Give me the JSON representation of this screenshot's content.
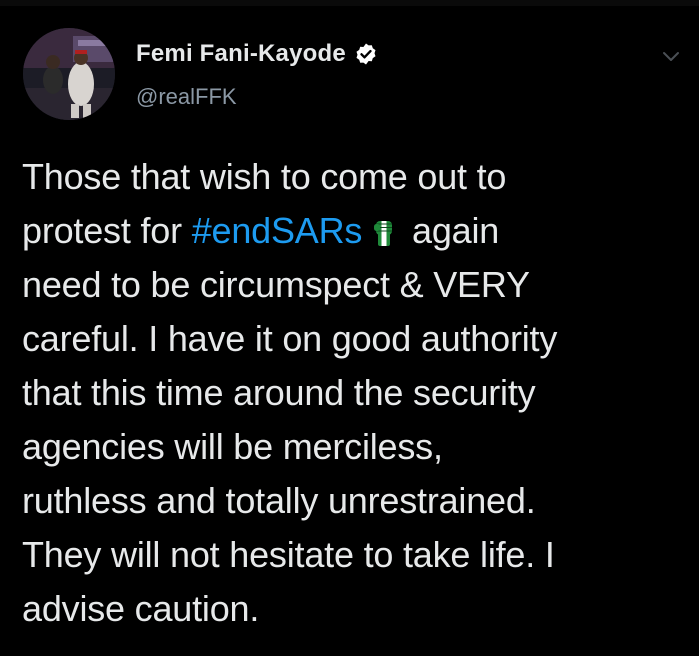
{
  "tweet": {
    "author": {
      "display_name": "Femi Fani-Kayode",
      "handle": "@realFFK",
      "verified": true
    },
    "menu_icon": "chevron-down-icon",
    "body": {
      "line1": "Those that wish to come out to",
      "line2_before": "protest for ",
      "line2_hashtag": "#endSARs",
      "line2_emoji": "raised-fist-nigeria-icon",
      "line2_after": " again",
      "line3": "need to be circumspect & VERY",
      "line4": "careful. I have it on good authority",
      "line5": "that this time around the security",
      "line6": "agencies will be merciless,",
      "line7": "ruthless and totally unrestrained.",
      "line8": "They will not hesitate to take life. I",
      "line9": "advise caution."
    }
  },
  "colors": {
    "background": "#000000",
    "text_primary": "#e7e9ea",
    "text_secondary": "#8b98a5",
    "link": "#1d9bf0",
    "verified_badge": "#ffffff",
    "fist_green": "#1f8a3a"
  }
}
